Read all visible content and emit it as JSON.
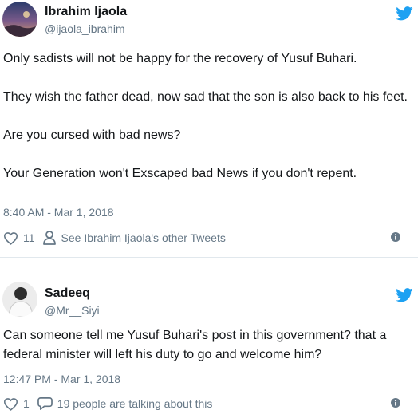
{
  "tweets": [
    {
      "author_name": "Ibrahim Ijaola",
      "author_handle": "@ijaola_ibrahim",
      "paragraphs": [
        "Only sadists will not be happy for the recovery of Yusuf Buhari.",
        "They wish the father dead, now sad that the son is also back to his feet.",
        "Are you cursed with bad news?",
        "Your Generation won't Exscaped bad News if you don't repent."
      ],
      "timestamp": "8:40 AM - Mar 1, 2018",
      "like_count": "11",
      "secondary_action": "See Ibrahim Ijaola's other Tweets"
    },
    {
      "author_name": "Sadeeq",
      "author_handle": "@Mr__Siyi",
      "paragraphs": [
        "Can someone tell me Yusuf Buhari's post in this government? that a federal minister will left his duty to go and welcome him?"
      ],
      "timestamp": "12:47 PM - Mar 1, 2018",
      "like_count": "1",
      "secondary_action": "19 people are talking about this"
    }
  ],
  "colors": {
    "twitter_blue": "#1da1f2",
    "text": "#14171a",
    "muted": "#657786",
    "divider": "#e1e8ed"
  },
  "icons": [
    "twitter-bird-icon",
    "heart-icon",
    "person-icon",
    "reply-bubble-icon",
    "info-icon"
  ]
}
